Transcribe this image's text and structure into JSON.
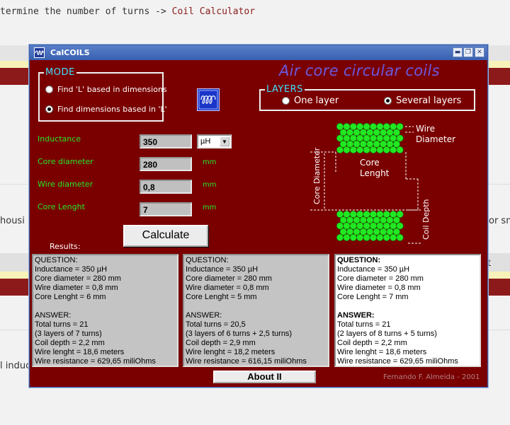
{
  "background": {
    "top_text": "termine the number of turns -> ",
    "top_link": "Coil Calculator",
    "left_fragment_1": "housi",
    "right_fragment_1": "or sm",
    "right_fragment_2": "t",
    "left_fragment_2": "l induc"
  },
  "window": {
    "title": "CalCOILS",
    "app_title": "Air core circular coils"
  },
  "mode": {
    "label": "MODE",
    "options": [
      {
        "label": "Find 'L' based in dimensions",
        "selected": false
      },
      {
        "label": "Find dimensions based in 'L'",
        "selected": true
      }
    ]
  },
  "layers": {
    "label": "LAYERS",
    "options": [
      {
        "label": "One layer",
        "selected": false
      },
      {
        "label": "Several layers",
        "selected": true
      }
    ]
  },
  "inputs": {
    "inductance": {
      "label": "Inductance",
      "value": "350",
      "unit": "µH"
    },
    "core_diameter": {
      "label": "Core diameter",
      "value": "280",
      "unit": "mm"
    },
    "wire_diameter": {
      "label": "Wire diameter",
      "value": "0,8",
      "unit": "mm"
    },
    "core_length": {
      "label": "Core Lenght",
      "value": "7",
      "unit": "mm"
    }
  },
  "calculate_label": "Calculate",
  "results_label": "Results:",
  "diagram": {
    "wire_diameter": [
      "Wire",
      "Diameter"
    ],
    "core_length": [
      "Core",
      "Lenght"
    ],
    "core_diameter": "Core Diameter",
    "coil_depth": "Coil Depth"
  },
  "results": [
    {
      "question": [
        "QUESTION:",
        "Inductance = 350 µH",
        "Core diameter = 280 mm",
        "Wire diameter = 0,8 mm",
        "Core Lenght = 6 mm"
      ],
      "answer": [
        "ANSWER:",
        "Total turns = 21",
        "(3 layers of 7 turns)",
        "Coil depth = 2,2 mm",
        "Wire lenght = 18,6 meters",
        "Wire resistance = 629,65 miliOhms"
      ]
    },
    {
      "question": [
        "QUESTION:",
        "Inductance = 350 µH",
        "Core diameter = 280 mm",
        "Wire diameter = 0,8 mm",
        "Core Lenght = 5 mm"
      ],
      "answer": [
        "ANSWER:",
        "Total turns = 20,5",
        "(3 layers of 6 turns + 2,5 turns)",
        "Coil depth = 2,9 mm",
        "Wire lenght = 18,2 meters",
        "Wire resistance = 616,15 miliOhms"
      ]
    },
    {
      "question": [
        "QUESTION:",
        "Inductance = 350 µH",
        "Core diameter = 280 mm",
        "Wire diameter = 0,8 mm",
        "Core Lenght = 7 mm"
      ],
      "answer": [
        "ANSWER:",
        "Total turns = 21",
        "(2 layers of 8 turns + 5 turns)",
        "Coil depth = 2,2 mm",
        "Wire lenght = 18,6 meters",
        "Wire resistance = 629,65 miliOhms"
      ]
    }
  ],
  "about_label": "About II",
  "credit": "Fernando F. Almeida - 2001",
  "colors": {
    "window_bg": "#7a0000",
    "green_label": "#25e825",
    "cyan_label": "#3fe0ff",
    "title_purple": "#6a5adf",
    "coil_green": "#22e822"
  }
}
